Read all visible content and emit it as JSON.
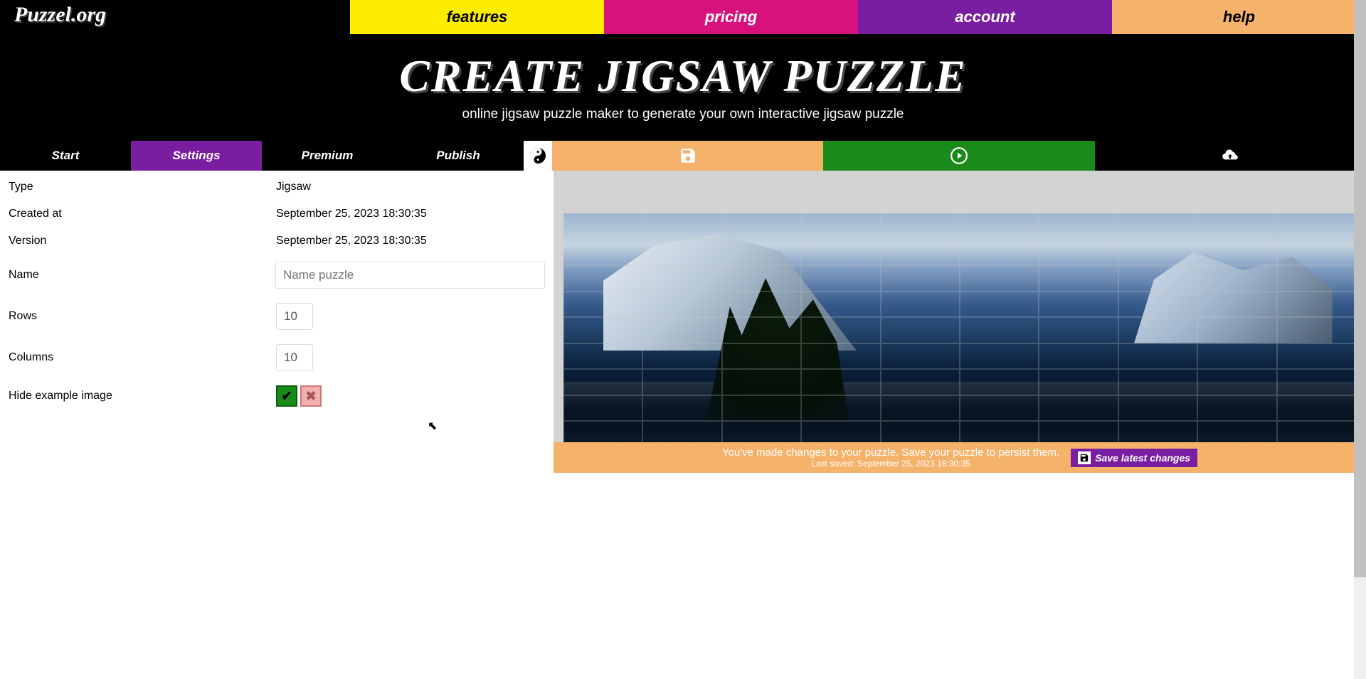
{
  "logo": "Puzzel.org",
  "nav": {
    "features": "features",
    "pricing": "pricing",
    "account": "account",
    "help": "help"
  },
  "hero": {
    "title": "CREATE JIGSAW PUZZLE",
    "sub": "online jigsaw puzzle maker to generate your own interactive jigsaw puzzle"
  },
  "tabs": {
    "start": "Start",
    "settings": "Settings",
    "premium": "Premium",
    "publish": "Publish"
  },
  "settings": {
    "type_label": "Type",
    "type_value": "Jigsaw",
    "created_label": "Created at",
    "created_value": "September 25, 2023 18:30:35",
    "version_label": "Version",
    "version_value": "September 25, 2023 18:30:35",
    "name_label": "Name",
    "name_placeholder": "Name puzzle",
    "rows_label": "Rows",
    "rows_value": "10",
    "columns_label": "Columns",
    "columns_value": "10",
    "hide_label": "Hide example image"
  },
  "footer": {
    "msg": "You've made changes to your puzzle. Save your puzzle to persist them.",
    "saved": "Last saved: September 25, 2023 18:30:35",
    "btn": "Save latest changes"
  },
  "toggle": {
    "yes": "✔",
    "no": "✖"
  }
}
